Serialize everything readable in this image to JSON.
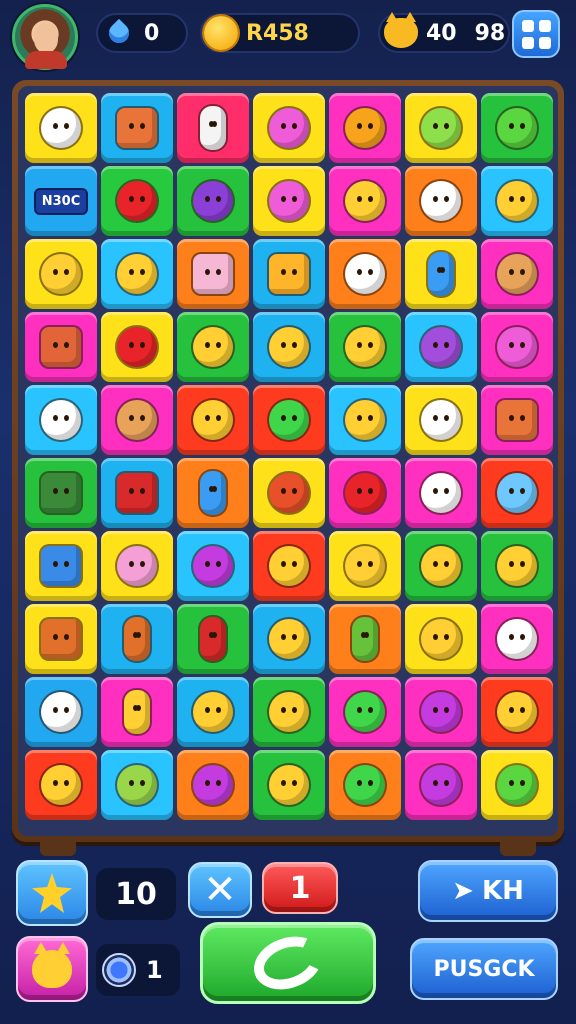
{
  "topbar": {
    "drop_count": "0",
    "coins": "R458",
    "score_a": "40",
    "score_b": "98"
  },
  "board": {
    "rows": [
      [
        {
          "c": "#ffe11a",
          "g": "#ffffff"
        },
        {
          "c": "#1fb2f0",
          "g": "#e8743a",
          "s": "sq"
        },
        {
          "c": "#ff2d6a",
          "g": "#f4f4f4",
          "s": "tall"
        },
        {
          "c": "#ffe11a",
          "g": "#ee5cd8"
        },
        {
          "c": "#ff2fbf",
          "g": "#f7a31b"
        },
        {
          "c": "#ffe11a",
          "g": "#8ee04a"
        },
        {
          "c": "#26c23d",
          "g": "#59d640"
        }
      ],
      [
        {
          "c": "#22a8f0",
          "label": "N30C"
        },
        {
          "c": "#27c93f",
          "g": "#e8242a"
        },
        {
          "c": "#26c23d",
          "g": "#8a3fd6"
        },
        {
          "c": "#ffe11a",
          "g": "#ee5cd8"
        },
        {
          "c": "#ff2fbf",
          "g": "#ffcf33"
        },
        {
          "c": "#ff7f1a",
          "g": "#ffffff"
        },
        {
          "c": "#29c3ff",
          "g": "#ffcf33"
        }
      ],
      [
        {
          "c": "#ffe11a",
          "g": "#ffcf33"
        },
        {
          "c": "#29c3ff",
          "g": "#ffcf33"
        },
        {
          "c": "#ff7f1a",
          "g": "#f6b7d4",
          "s": "sq"
        },
        {
          "c": "#1fb2f0",
          "g": "#ffb52a",
          "s": "sq"
        },
        {
          "c": "#ff7f1a",
          "g": "#ffffff"
        },
        {
          "c": "#ffe11a",
          "g": "#3a9cf2",
          "s": "tall"
        },
        {
          "c": "#ff2fbf",
          "g": "#e7a35a"
        }
      ],
      [
        {
          "c": "#ff2fbf",
          "g": "#e2653a",
          "s": "sq"
        },
        {
          "c": "#ffe11a",
          "g": "#e8242a"
        },
        {
          "c": "#26c23d",
          "g": "#ffcf33"
        },
        {
          "c": "#1fb2f0",
          "g": "#ffcf33"
        },
        {
          "c": "#26c23d",
          "g": "#ffcf33"
        },
        {
          "c": "#29c3ff",
          "g": "#a24ddb"
        },
        {
          "c": "#ff2fbf",
          "g": "#ee5cd8"
        }
      ],
      [
        {
          "c": "#29c3ff",
          "g": "#ffffff"
        },
        {
          "c": "#ff2fbf",
          "g": "#e7a35a"
        },
        {
          "c": "#ff3b1f",
          "g": "#ffcf33"
        },
        {
          "c": "#ff3b1f",
          "g": "#3fd64a"
        },
        {
          "c": "#29c3ff",
          "g": "#ffcf33"
        },
        {
          "c": "#ffe11a",
          "g": "#ffffff"
        },
        {
          "c": "#ff2fbf",
          "g": "#e8743a",
          "s": "sq"
        }
      ],
      [
        {
          "c": "#26c23d",
          "g": "#3a8a3a",
          "s": "sq"
        },
        {
          "c": "#1fb2f0",
          "g": "#d82a2a",
          "s": "sq"
        },
        {
          "c": "#ff7f1a",
          "g": "#3a9cf2",
          "s": "tall"
        },
        {
          "c": "#ffe11a",
          "g": "#e8502a"
        },
        {
          "c": "#ff2fbf",
          "g": "#e8242a"
        },
        {
          "c": "#ff2fbf",
          "g": "#ffffff"
        },
        {
          "c": "#ff3b1f",
          "g": "#6ec8ff"
        }
      ],
      [
        {
          "c": "#ffe11a",
          "g": "#3a8ae8",
          "s": "sq"
        },
        {
          "c": "#ffe11a",
          "g": "#f4a0d6"
        },
        {
          "c": "#29c3ff",
          "g": "#c43be0"
        },
        {
          "c": "#ff3b1f",
          "g": "#ffcf33"
        },
        {
          "c": "#ffe11a",
          "g": "#ffcf33"
        },
        {
          "c": "#26c23d",
          "g": "#ffcf33"
        },
        {
          "c": "#26c23d",
          "g": "#ffcf33"
        }
      ],
      [
        {
          "c": "#ffe11a",
          "g": "#e0702a",
          "s": "sq"
        },
        {
          "c": "#1fb2f0",
          "g": "#e0702a",
          "s": "tall"
        },
        {
          "c": "#26c23d",
          "g": "#d82a2a",
          "s": "tall"
        },
        {
          "c": "#1fb2f0",
          "g": "#ffcf33"
        },
        {
          "c": "#ff7f1a",
          "g": "#66c23a",
          "s": "tall"
        },
        {
          "c": "#ffe11a",
          "g": "#ffcf33"
        },
        {
          "c": "#ff2fbf",
          "g": "#ffffff"
        }
      ],
      [
        {
          "c": "#22a8f0",
          "g": "#ffffff"
        },
        {
          "c": "#ff2fbf",
          "g": "#ffcf33",
          "s": "tall"
        },
        {
          "c": "#1fb2f0",
          "g": "#ffcf33"
        },
        {
          "c": "#26c23d",
          "g": "#ffcf33"
        },
        {
          "c": "#ff2fbf",
          "g": "#3fd64a"
        },
        {
          "c": "#ff2fbf",
          "g": "#c43be0"
        },
        {
          "c": "#ff3b1f",
          "g": "#ffcf33"
        }
      ],
      [
        {
          "c": "#ff3b1f",
          "g": "#ffcf33"
        },
        {
          "c": "#29c3ff",
          "g": "#9ad64a"
        },
        {
          "c": "#ff7f1a",
          "g": "#c43be0"
        },
        {
          "c": "#26c23d",
          "g": "#ffcf33"
        },
        {
          "c": "#ff7f1a",
          "g": "#3fd64a"
        },
        {
          "c": "#ff2fbf",
          "g": "#c43be0"
        },
        {
          "c": "#ffe11a",
          "g": "#59d640"
        }
      ]
    ]
  },
  "controls": {
    "count_a": "10",
    "red_value": "1",
    "kh_label": "KH",
    "count_b": "1",
    "pus_label": "PUSGCK"
  }
}
